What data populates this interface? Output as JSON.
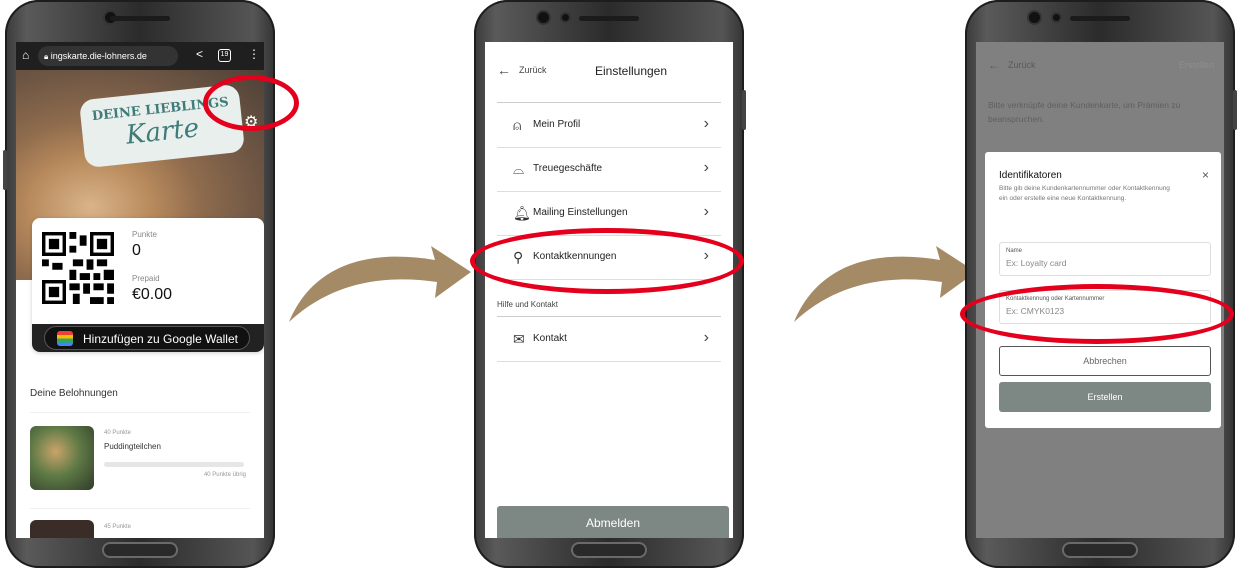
{
  "phone1": {
    "browser": {
      "url": "ingskarte.die-lohners.de",
      "tabs_count": "19"
    },
    "logo": {
      "line1": "DEINE LIEBLINGS",
      "line2": "Karte"
    },
    "card": {
      "points_label": "Punkte",
      "points_value": "0",
      "prepaid_label": "Prepaid",
      "prepaid_value": "€0.00",
      "wallet_button": "Hinzufügen zu Google Wallet"
    },
    "rewards": {
      "title": "Deine Belohnungen",
      "items": [
        {
          "points": "40 Punkte",
          "name": "Puddingteilchen",
          "remaining": "40 Punkte übrig",
          "progress": 0.0
        },
        {
          "points": "45 Punkte"
        }
      ]
    }
  },
  "phone2": {
    "header": {
      "back": "Zurück",
      "title": "Einstellungen"
    },
    "menu": [
      {
        "label": "Mein Profil",
        "icon": "user-icon"
      },
      {
        "label": "Treuegeschäfte",
        "icon": "store-icon"
      },
      {
        "label": "Mailing Einstellungen",
        "icon": "bell-icon"
      },
      {
        "label": "Kontaktkennungen",
        "icon": "search-icon"
      }
    ],
    "section_help": "Hilfe und Kontakt",
    "contact": {
      "label": "Kontakt",
      "icon": "mail-icon"
    },
    "logout": "Abmelden"
  },
  "phone3": {
    "header": {
      "back": "Zurück",
      "action": "Erstellen"
    },
    "intro": "Bitte verknüpfe deine Kundenkarte, um Prämien zu beanspruchen.",
    "dialog": {
      "title": "Identifikatoren",
      "description": "Bitte gib deine Kundenkartennummer oder Kontaktkennung ein oder erstelle eine neue Kontaktkennung.",
      "name_label": "Name",
      "name_placeholder": "Ex: Loyalty card",
      "id_label": "Kontaktkennung oder Kartennummer",
      "id_placeholder": "Ex: CMYK0123",
      "cancel": "Abbrechen",
      "create": "Erstellen"
    }
  },
  "colors": {
    "highlight": "#e4001c",
    "arrow": "#a58a66",
    "button_gray": "#7d8784",
    "teal": "#3f7b78"
  }
}
